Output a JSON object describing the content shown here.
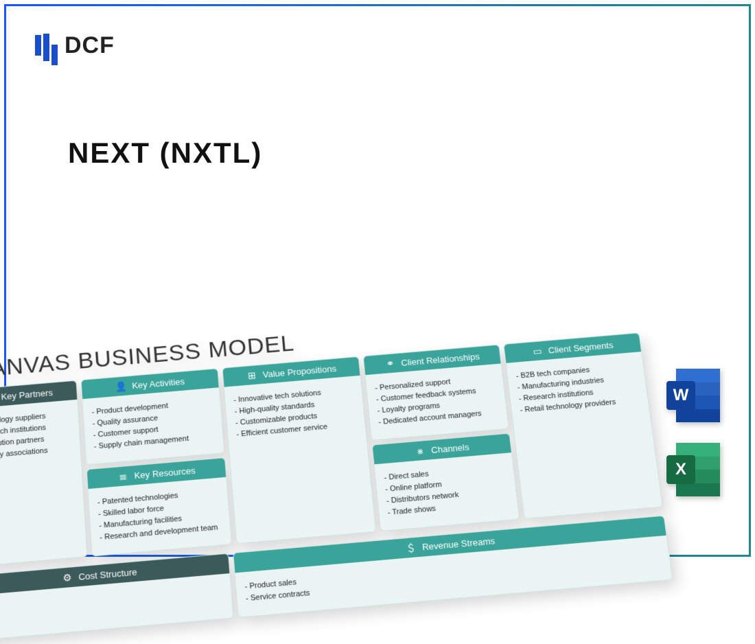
{
  "brand": "DCF",
  "title": "NEXT (NXTL)",
  "canvas": {
    "heading": "CANVAS BUSINESS MODEL",
    "sections": {
      "key_partners": {
        "label": "Key Partners",
        "items": [
          "Technology suppliers",
          "Research institutions",
          "Distribution partners",
          "Industry associations"
        ]
      },
      "key_activities": {
        "label": "Key Activities",
        "items": [
          "Product development",
          "Quality assurance",
          "Customer support",
          "Supply chain management"
        ]
      },
      "key_resources": {
        "label": "Key Resources",
        "items": [
          "Patented technologies",
          "Skilled labor force",
          "Manufacturing facilities",
          "Research and development team"
        ]
      },
      "value_propositions": {
        "label": "Value Propositions",
        "items": [
          "Innovative tech solutions",
          "High-quality standards",
          "Customizable products",
          "Efficient customer service"
        ]
      },
      "client_relationships": {
        "label": "Client Relationships",
        "items": [
          "Personalized support",
          "Customer feedback systems",
          "Loyalty programs",
          "Dedicated account managers"
        ]
      },
      "channels": {
        "label": "Channels",
        "items": [
          "Direct sales",
          "Online platform",
          "Distributors network",
          "Trade shows"
        ]
      },
      "client_segments": {
        "label": "Client Segments",
        "items": [
          "B2B tech companies",
          "Manufacturing industries",
          "Research institutions",
          "Retail technology providers"
        ]
      },
      "cost_structure": {
        "label": "Cost Structure",
        "items": []
      },
      "revenue_streams": {
        "label": "Revenue Streams",
        "items": [
          "Product sales",
          "Service contracts"
        ]
      }
    }
  },
  "apps": {
    "word": "W",
    "excel": "X"
  }
}
